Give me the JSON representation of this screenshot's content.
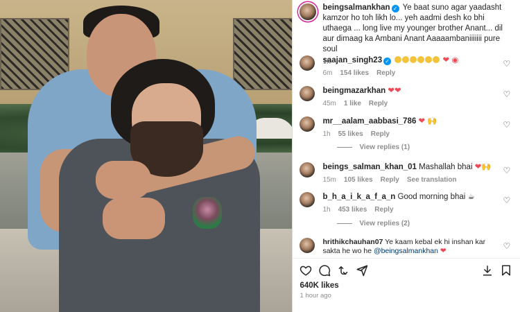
{
  "post": {
    "author": "beingsalmankhan",
    "caption": "Ye baat suno agar yaadasht kamzor ho toh likh lo... yeh aadmi desh ko bhi uthaega ... long live my younger brother Anant... dil aur dimaag ka Ambani Anant Aaaaambaniiiiiii pure soul",
    "age": "1h",
    "likes": "640K likes",
    "posted": "1 hour ago"
  },
  "comments": [
    {
      "user": "saajan_singh23",
      "text": "",
      "emoji_count": 6,
      "suffix": "❤ ◉",
      "time": "6m",
      "likes": "154 likes",
      "reply": "Reply",
      "extra": ""
    },
    {
      "user": "beingmazarkhan",
      "text": "",
      "suffix": "❤❤",
      "time": "45m",
      "likes": "1 like",
      "reply": "Reply",
      "extra": ""
    },
    {
      "user": "mr__aalam_aabbasi_786",
      "text": "",
      "suffix": "❤ 🙌",
      "time": "1h",
      "likes": "55 likes",
      "reply": "Reply",
      "extra": "",
      "view_replies": "View replies (1)"
    },
    {
      "user": "beings_salman_khan_01",
      "text": "Mashallah bhai",
      "suffix": "❤🙌",
      "time": "15m",
      "likes": "105 likes",
      "reply": "Reply",
      "extra": "See translation"
    },
    {
      "user": "b_h_a_i_k_a_f_a_n",
      "text": "Good morning bhai",
      "suffix": "☕",
      "time": "1h",
      "likes": "453 likes",
      "reply": "Reply",
      "extra": "",
      "view_replies": "View replies (2)"
    },
    {
      "user": "hrithikchauhan07",
      "text": "Ye kaam kebal ek hi inshan kar sakta he wo he",
      "mention": "@beingsalmankhan",
      "suffix": "❤",
      "time": "",
      "likes": "",
      "reply": "",
      "extra": ""
    }
  ],
  "icons": {
    "like": "heart-icon",
    "comment": "comment-icon",
    "share": "share-icon",
    "send": "send-icon",
    "save": "save-icon",
    "verified": "verified-badge-icon"
  },
  "colors": {
    "accent": "#0095f6",
    "heart": "#ed4956",
    "muted": "#8e8e8e"
  }
}
